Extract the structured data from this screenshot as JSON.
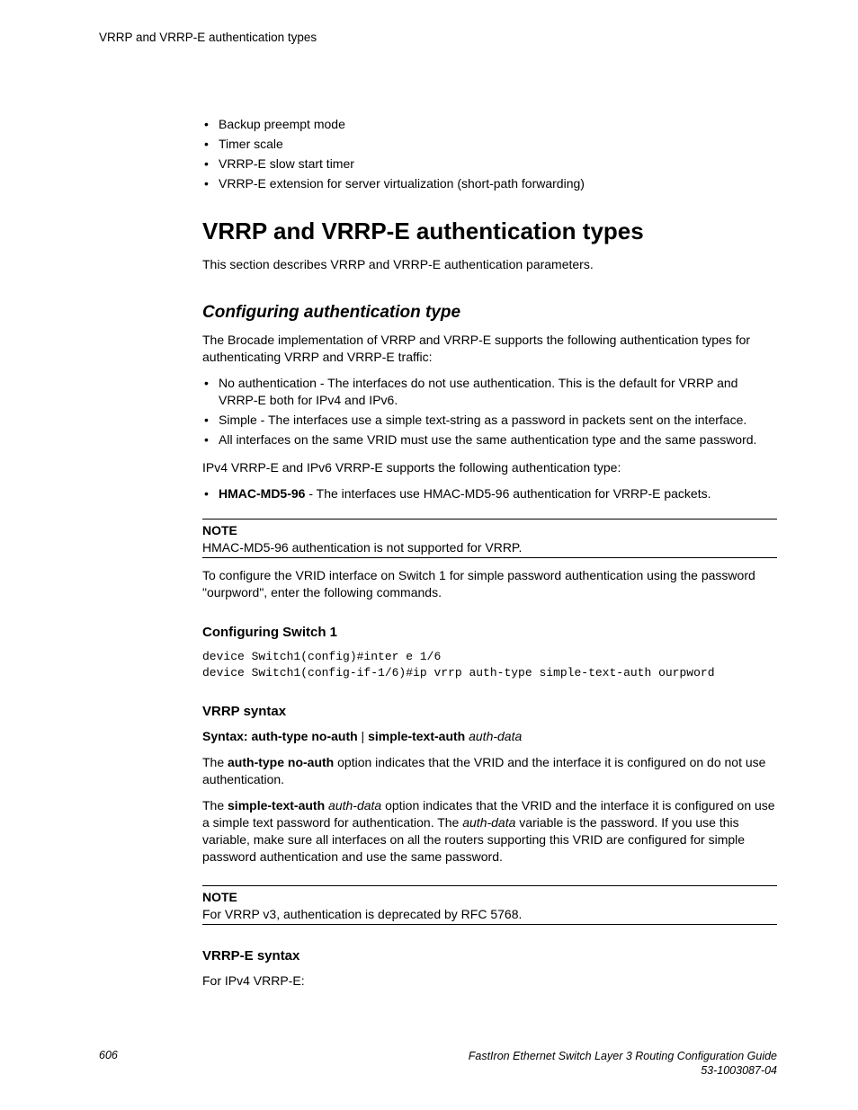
{
  "running_head": "VRRP and VRRP-E authentication types",
  "top_list": [
    "Backup preempt mode",
    "Timer scale",
    "VRRP-E slow start timer",
    "VRRP-E extension for server virtualization (short-path forwarding)"
  ],
  "h1": "VRRP and VRRP-E authentication types",
  "intro": "This section describes VRRP and VRRP-E authentication parameters.",
  "h2": "Configuring authentication type",
  "p2": "The Brocade implementation of VRRP and VRRP-E supports the following authentication types for authenticating VRRP and VRRP-E traffic:",
  "auth_list": [
    "No authentication - The interfaces do not use authentication. This is the default for VRRP and VRRP-E both for IPv4 and IPv6.",
    "Simple - The interfaces use a simple text-string as a password in packets sent on the interface.",
    "All interfaces on the same VRID must use the same authentication type and the same password."
  ],
  "p3": "IPv4 VRRP-E and IPv6 VRRP-E supports the following authentication type:",
  "hmac_label": "HMAC-MD5-96",
  "hmac_rest": " - The interfaces use HMAC-MD5-96 authentication for VRRP-E packets.",
  "note1_label": "NOTE",
  "note1_body": "HMAC-MD5-96 authentication is not supported for VRRP.",
  "p4": "To configure the VRID interface on Switch 1 for simple password authentication using the password \"ourpword\", enter the following commands.",
  "h3a": "Configuring Switch 1",
  "code": "device Switch1(config)#inter e 1/6\ndevice Switch1(config-if-1/6)#ip vrrp auth-type simple-text-auth ourpword",
  "h3b": "VRRP syntax",
  "syntax_prefix": "Syntax: auth-type no-auth",
  "syntax_pipe": " | ",
  "syntax_mid": "simple-text-auth",
  "syntax_var": " auth-data",
  "p5a": "The ",
  "p5b": "auth-type no-auth",
  "p5c": " option indicates that the VRID and the interface it is configured on do not use authentication.",
  "p6a": "The ",
  "p6b": "simple-text-auth",
  "p6c": " ",
  "p6d": "auth-data",
  "p6e": " option indicates that the VRID and the interface it is configured on use a simple text password for authentication. The ",
  "p6f": "auth-data",
  "p6g": " variable is the password. If you use this variable, make sure all interfaces on all the routers supporting this VRID are configured for simple password authentication and use the same password.",
  "note2_label": "NOTE",
  "note2_body": "For VRRP v3, authentication is deprecated by RFC 5768.",
  "h3c": "VRRP-E syntax",
  "p7": "For IPv4 VRRP-E:",
  "footer_page": "606",
  "footer_title": "FastIron Ethernet Switch Layer 3 Routing Configuration Guide",
  "footer_doc": "53-1003087-04"
}
